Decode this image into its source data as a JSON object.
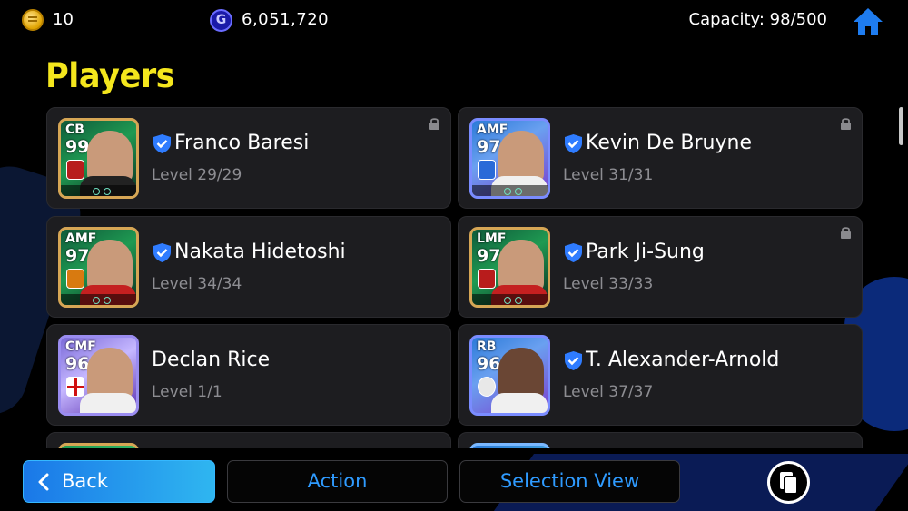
{
  "topbar": {
    "coins": "10",
    "gp": "6,051,720",
    "gp_icon_letter": "G",
    "capacity": "Capacity: 98/500",
    "icons": [
      "coin-icon",
      "gp-icon",
      "home-icon"
    ]
  },
  "page": {
    "title": "Players"
  },
  "players": [
    {
      "position": "CB",
      "rating": "99",
      "name": "Franco Baresi",
      "level": "Level 29/29",
      "verified": true,
      "locked": true
    },
    {
      "position": "AMF",
      "rating": "97",
      "name": "Kevin De Bruyne",
      "level": "Level 31/31",
      "verified": true,
      "locked": true
    },
    {
      "position": "AMF",
      "rating": "97",
      "name": "Nakata Hidetoshi",
      "level": "Level 34/34",
      "verified": true,
      "locked": false
    },
    {
      "position": "LMF",
      "rating": "97",
      "name": "Park Ji-Sung",
      "level": "Level 33/33",
      "verified": true,
      "locked": true
    },
    {
      "position": "CMF",
      "rating": "96",
      "name": "Declan Rice",
      "level": "Level 1/1",
      "verified": false,
      "locked": false
    },
    {
      "position": "RB",
      "rating": "96",
      "name": "T. Alexander-Arnold",
      "level": "Level 37/37",
      "verified": true,
      "locked": false
    }
  ],
  "bottombar": {
    "back_label": "Back",
    "action_label": "Action",
    "selection_label": "Selection View"
  },
  "colors": {
    "title_yellow": "#f4e61d",
    "accent_blue": "#2f9bff",
    "verified_blue": "#2f7cff"
  }
}
